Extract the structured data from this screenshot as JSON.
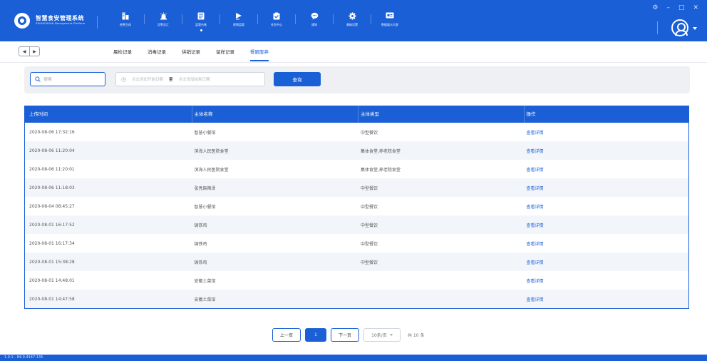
{
  "app": {
    "title": "智慧食安管理系统",
    "subtitle": "ZHIHUISHIAN Management Platform"
  },
  "nav": [
    {
      "label": "经营主体",
      "icon": "building-icon"
    },
    {
      "label": "告警总汇",
      "icon": "alarm-icon"
    },
    {
      "label": "监管台账",
      "icon": "ledger-icon"
    },
    {
      "label": "视频监管",
      "icon": "video-icon"
    },
    {
      "label": "任务中心",
      "icon": "task-icon"
    },
    {
      "label": "通知",
      "icon": "chat-icon"
    },
    {
      "label": "基础设置",
      "icon": "gear-icon"
    },
    {
      "label": "数据展示大屏",
      "icon": "screen-icon"
    }
  ],
  "active_nav": 2,
  "tabs": [
    "晨检记录",
    "消毒记录",
    "供销记录",
    "留样记录",
    "餐厨废弃"
  ],
  "active_tab": 4,
  "filter": {
    "search_placeholder": "搜索",
    "start_placeholder": "点击添加开始日期",
    "separator": "至",
    "end_placeholder": "点击添加结束日期",
    "query_label": "查询"
  },
  "table": {
    "headers": [
      "上传时间",
      "主体名称",
      "主体类型",
      "操作"
    ],
    "action_label": "查看详情",
    "rows": [
      {
        "time": "2020-08-06 17:32:16",
        "name": "智慧小餐馆",
        "type": "中型餐饮"
      },
      {
        "time": "2020-08-06 11:20:04",
        "name": "滨海人民医院食堂",
        "type": "集体食堂,养老院食堂"
      },
      {
        "time": "2020-08-06 11:20:01",
        "name": "滨海人民医院食堂",
        "type": "集体食堂,养老院食堂"
      },
      {
        "time": "2020-08-06 11:18:03",
        "name": "张亮麻辣烫",
        "type": "中型餐饮"
      },
      {
        "time": "2020-08-04 08:45:27",
        "name": "智慧小餐馆",
        "type": "中型餐饮"
      },
      {
        "time": "2020-08-01 16:17:52",
        "name": "铸铁鸡",
        "type": "中型餐饮"
      },
      {
        "time": "2020-08-01 16:17:34",
        "name": "铸铁鸡",
        "type": "中型餐饮"
      },
      {
        "time": "2020-08-01 15:38:28",
        "name": "铸铁鸡",
        "type": "中型餐饮"
      },
      {
        "time": "2020-08-01 14:48:01",
        "name": "安徽土菜馆",
        "type": ""
      },
      {
        "time": "2020-08-01 14:47:58",
        "name": "安徽土菜馆",
        "type": ""
      }
    ]
  },
  "pagination": {
    "prev": "上一页",
    "page": "1",
    "next": "下一页",
    "page_size": "10条/页",
    "total": "共 10 条"
  },
  "footer": {
    "version": "1.0.1 - 84.0.4147.135"
  },
  "window_controls": [
    "⚙",
    "–",
    "□",
    "✕"
  ]
}
